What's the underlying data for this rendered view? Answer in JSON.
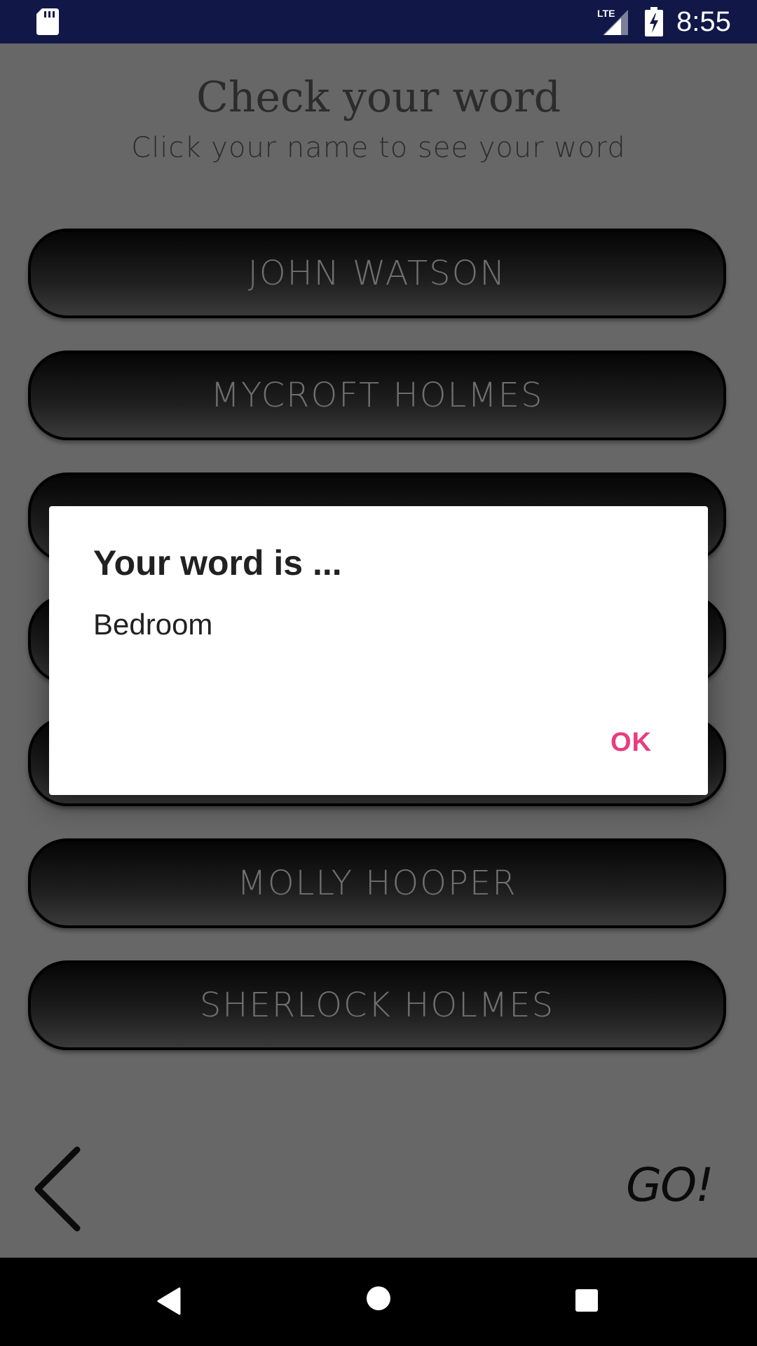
{
  "status_bar": {
    "time": "8:55",
    "network_label": "LTE",
    "icons": [
      "sd-card-icon",
      "lte-signal-icon",
      "battery-charging-icon"
    ]
  },
  "page": {
    "title": "Check your word",
    "subtitle": "Click your name to see your word"
  },
  "players": [
    {
      "name": "JOHN WATSON"
    },
    {
      "name": "MYCROFT HOLMES"
    },
    {
      "name": ""
    },
    {
      "name": ""
    },
    {
      "name": ""
    },
    {
      "name": "MOLLY HOOPER"
    },
    {
      "name": "SHERLOCK HOLMES"
    }
  ],
  "footer": {
    "back_icon": "chevron-left-icon",
    "go_label": "GO!"
  },
  "dialog": {
    "title": "Your word is ...",
    "message": "Bedroom",
    "ok_label": "OK"
  },
  "nav_bar": {
    "icons": [
      "back-triangle-icon",
      "home-circle-icon",
      "recents-square-icon"
    ]
  },
  "colors": {
    "status_bar": "#111848",
    "background": "#676767",
    "accent": "#e93c7f",
    "dialog_background": "#ffffff"
  }
}
